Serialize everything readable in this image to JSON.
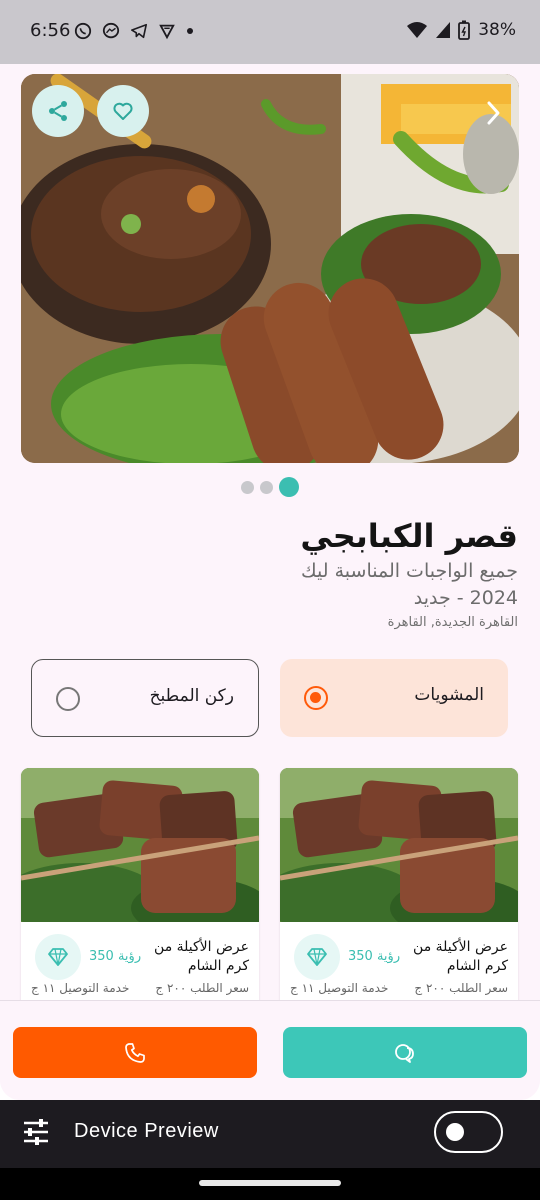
{
  "status_bar": {
    "time": "6:56",
    "battery": "38%",
    "notification_icons": [
      "whatsapp-icon",
      "messenger-icon",
      "telegram-icon",
      "vpn-icon",
      "dot-icon"
    ],
    "status_icons": [
      "wifi-icon",
      "signal-icon",
      "battery-icon"
    ]
  },
  "gallery": {
    "page_count": 3,
    "active_page": 3,
    "actions": [
      "share-icon",
      "heart-icon",
      "chevron-right-icon"
    ]
  },
  "restaurant": {
    "name": "قصر الكبابجي",
    "subtitle": "جميع الواجبات المناسبة ليك",
    "year_line": "2024 - جديد",
    "location": "القاهرة الجديدة, القاهرة"
  },
  "categories": [
    {
      "label": "المشويات",
      "selected": true
    },
    {
      "label": "ركن المطبخ",
      "selected": false
    }
  ],
  "offers": [
    {
      "title": "عرض الأكيلة من كرم الشام",
      "views": "رؤية 350",
      "price": "سعر الطلب ٢٠٠ ج",
      "delivery": "خدمة التوصيل ١١ ج"
    },
    {
      "title": "عرض الأكيلة من كرم الشام",
      "views": "رؤية 350",
      "price": "سعر الطلب ٢٠٠ ج",
      "delivery": "خدمة التوصيل ١١ ج"
    }
  ],
  "actions": {
    "call_icon": "phone-icon",
    "chat_icon": "chat-icon",
    "call_color": "#ff5a00",
    "chat_color": "#3dc7b8"
  },
  "device_preview": {
    "title": "Device Preview",
    "enabled": false
  },
  "colors": {
    "accent": "#3bbeb1",
    "selected_category_bg": "#fde4d9",
    "radio_active": "#ff5a0a"
  }
}
